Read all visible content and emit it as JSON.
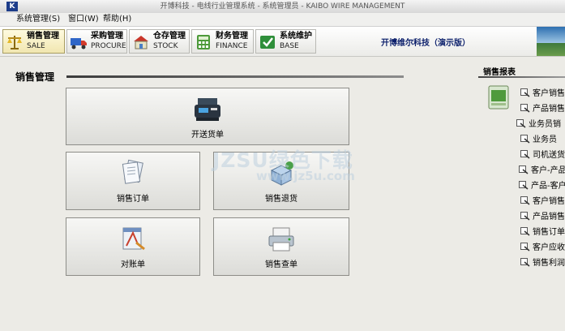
{
  "window": {
    "title": "开博科技 - 电线行业管理系统 - 系统管理员 - KAIBO WIRE MANAGEMENT",
    "app_icon": "K"
  },
  "menu": [
    "系统管理(S)",
    "窗口(W)",
    "帮助(H)"
  ],
  "toolbar": {
    "buttons": [
      {
        "label": "销售管理",
        "sub": "SALE"
      },
      {
        "label": "采购管理",
        "sub": "PROCURE"
      },
      {
        "label": "仓存管理",
        "sub": "STOCK"
      },
      {
        "label": "财务管理",
        "sub": "FINANCE"
      },
      {
        "label": "系统维护",
        "sub": "BASE"
      }
    ],
    "company": "开博维尔科技（演示版）"
  },
  "main": {
    "title": "销售管理",
    "buttons": [
      "开送货单",
      "销售订单",
      "销售退货",
      "对账单",
      "销售查单"
    ]
  },
  "watermark": {
    "line1": "JZSU绿色下载",
    "line2": "www.jz5u.com"
  },
  "reports": {
    "title": "销售报表",
    "items": [
      "客户销售",
      "产品销售",
      "业务员销",
      "业务员",
      "司机送货",
      "客户-产品",
      "产品-客户",
      "客户销售",
      "产品销售",
      "销售订单",
      "客户应收",
      "销售利润"
    ]
  },
  "colors": {
    "company_text": "#0b1f6b",
    "active_button": "#f1e6b0"
  }
}
